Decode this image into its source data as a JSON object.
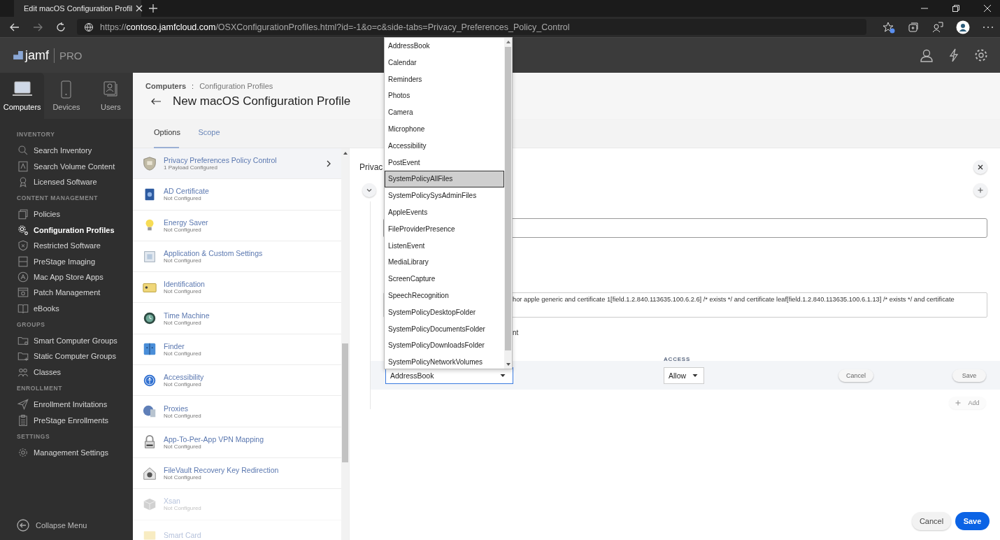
{
  "browser": {
    "tab_title": "Edit macOS Configuration Profil",
    "url": {
      "scheme": "https://",
      "host": "contoso.jamfcloud.com",
      "path": "/OSXConfigurationProfiles.html?id=-1&o=c&side-tabs=Privacy_Preferences_Policy_Control"
    }
  },
  "app": {
    "logo": "jamf",
    "edition": "PRO"
  },
  "top_tabs": [
    {
      "label": "Computers",
      "selected": true
    },
    {
      "label": "Devices",
      "selected": false
    },
    {
      "label": "Users",
      "selected": false
    }
  ],
  "nav": [
    {
      "heading": "INVENTORY",
      "items": [
        {
          "label": "Search Inventory",
          "selected": false
        },
        {
          "label": "Search Volume Content",
          "selected": false
        },
        {
          "label": "Licensed Software",
          "selected": false
        }
      ]
    },
    {
      "heading": "CONTENT MANAGEMENT",
      "items": [
        {
          "label": "Policies",
          "selected": false
        },
        {
          "label": "Configuration Profiles",
          "selected": true
        },
        {
          "label": "Restricted Software",
          "selected": false
        },
        {
          "label": "PreStage Imaging",
          "selected": false
        },
        {
          "label": "Mac App Store Apps",
          "selected": false
        },
        {
          "label": "Patch Management",
          "selected": false
        },
        {
          "label": "eBooks",
          "selected": false
        }
      ]
    },
    {
      "heading": "GROUPS",
      "items": [
        {
          "label": "Smart Computer Groups",
          "selected": false
        },
        {
          "label": "Static Computer Groups",
          "selected": false
        },
        {
          "label": "Classes",
          "selected": false
        }
      ]
    },
    {
      "heading": "ENROLLMENT",
      "items": [
        {
          "label": "Enrollment Invitations",
          "selected": false
        },
        {
          "label": "PreStage Enrollments",
          "selected": false
        }
      ]
    },
    {
      "heading": "SETTINGS",
      "items": [
        {
          "label": "Management Settings",
          "selected": false
        }
      ]
    }
  ],
  "collapse_label": "Collapse Menu",
  "breadcrumb": {
    "parent": "Computers",
    "separator": ":",
    "current": "Configuration Profiles"
  },
  "title": "New macOS Configuration Profile",
  "content_tabs": [
    {
      "label": "Options",
      "selected": true
    },
    {
      "label": "Scope",
      "selected": false
    }
  ],
  "payloads": [
    {
      "name": "Privacy Preferences Policy Control",
      "status": "1 Payload Configured",
      "selected": true,
      "faded": false
    },
    {
      "name": "AD Certificate",
      "status": "Not Configured",
      "selected": false,
      "faded": false
    },
    {
      "name": "Energy Saver",
      "status": "Not Configured",
      "selected": false,
      "faded": false
    },
    {
      "name": "Application & Custom Settings",
      "status": "Not Configured",
      "selected": false,
      "faded": false
    },
    {
      "name": "Identification",
      "status": "Not Configured",
      "selected": false,
      "faded": false
    },
    {
      "name": "Time Machine",
      "status": "Not Configured",
      "selected": false,
      "faded": false
    },
    {
      "name": "Finder",
      "status": "Not Configured",
      "selected": false,
      "faded": false
    },
    {
      "name": "Accessibility",
      "status": "Not Configured",
      "selected": false,
      "faded": false
    },
    {
      "name": "Proxies",
      "status": "Not Configured",
      "selected": false,
      "faded": false
    },
    {
      "name": "App-To-Per-App VPN Mapping",
      "status": "Not Configured",
      "selected": false,
      "faded": false
    },
    {
      "name": "FileVault Recovery Key Redirection",
      "status": "Not Configured",
      "selected": false,
      "faded": false
    },
    {
      "name": "Xsan",
      "status": "Not Configured",
      "selected": false,
      "faded": true
    },
    {
      "name": "Smart Card",
      "selected": false,
      "faded": true
    }
  ],
  "panel": {
    "heading": "Privac",
    "requirement_text": "hor apple generic and certificate 1[field.1.2.840.113635.100.6.2.6] /* exists */ and certificate leaf[field.1.2.840.113635.100.6.1.13] /* exists */ and certificate",
    "checkbox_label": "nt",
    "access_header": "ACCESS",
    "row": {
      "app_service": "AddressBook",
      "access": "Allow",
      "cancel": "Cancel",
      "save": "Save"
    },
    "add_label": "Add",
    "add_disabled": true
  },
  "dropdown": {
    "options": [
      {
        "label": "AddressBook",
        "selected": false
      },
      {
        "label": "Calendar",
        "selected": false
      },
      {
        "label": "Reminders",
        "selected": false
      },
      {
        "label": "Photos",
        "selected": false
      },
      {
        "label": "Camera",
        "selected": false
      },
      {
        "label": "Microphone",
        "selected": false
      },
      {
        "label": "Accessibility",
        "selected": false
      },
      {
        "label": "PostEvent",
        "selected": false
      },
      {
        "label": "SystemPolicyAllFiles",
        "selected": true
      },
      {
        "label": "SystemPolicySysAdminFiles",
        "selected": false
      },
      {
        "label": "AppleEvents",
        "selected": false
      },
      {
        "label": "FileProviderPresence",
        "selected": false
      },
      {
        "label": "ListenEvent",
        "selected": false
      },
      {
        "label": "MediaLibrary",
        "selected": false
      },
      {
        "label": "ScreenCapture",
        "selected": false
      },
      {
        "label": "SpeechRecognition",
        "selected": false
      },
      {
        "label": "SystemPolicyDesktopFolder",
        "selected": false
      },
      {
        "label": "SystemPolicyDocumentsFolder",
        "selected": false
      },
      {
        "label": "SystemPolicyDownloadsFolder",
        "selected": false
      },
      {
        "label": "SystemPolicyNetworkVolumes",
        "selected": false
      }
    ]
  },
  "footer": {
    "cancel": "Cancel",
    "save": "Save"
  }
}
